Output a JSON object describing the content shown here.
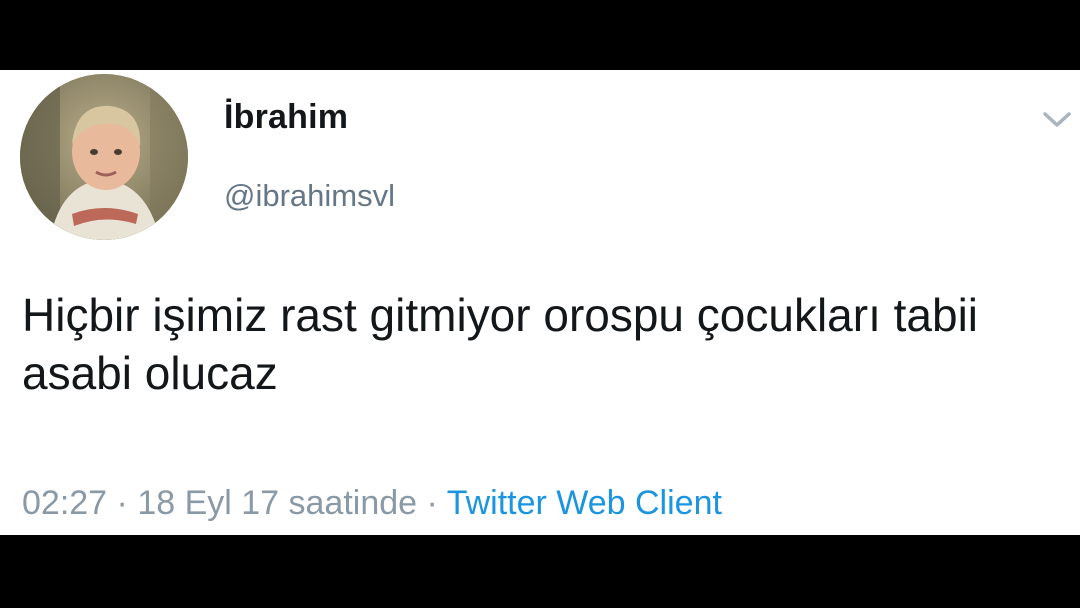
{
  "tweet": {
    "display_name": "İbrahim",
    "handle": "@ibrahimsvl",
    "text": "Hiçbir işimiz rast gitmiyor orospu çocukları tabii asabi olucaz",
    "time": "02:27",
    "separator": " · ",
    "date": "18 Eyl 17 saatinde",
    "separator2": " · ",
    "source": "Twitter Web Client"
  },
  "icons": {
    "menu": "chevron-down-icon",
    "avatar": "avatar-photo"
  },
  "colors": {
    "background_bars": "#000000",
    "card": "#ffffff",
    "text_primary": "#14171a",
    "text_secondary": "#657786",
    "link": "#1b95e0"
  }
}
